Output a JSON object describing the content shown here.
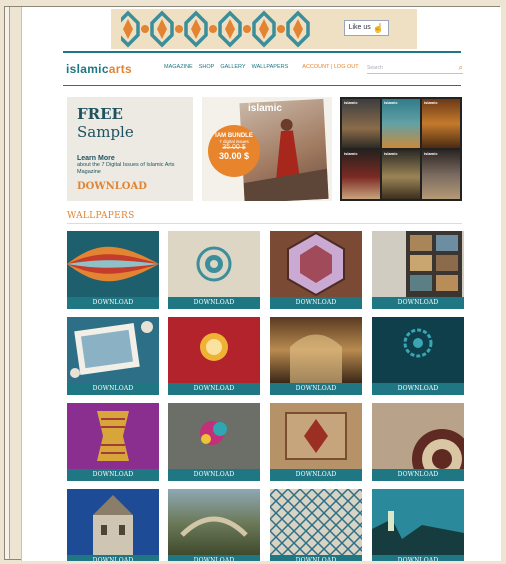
{
  "banner": {
    "like_label": "Like us"
  },
  "site": {
    "logo_main": "islamic",
    "logo_accent": "arts"
  },
  "nav": {
    "items": [
      "MAGAZINE",
      "SHOP",
      "GALLERY",
      "WALLPAPERS"
    ],
    "account": "ACCOUNT | LOG OUT"
  },
  "search": {
    "placeholder": "Search"
  },
  "promo": {
    "title_bold": "FREE",
    "title_rest": " Sample",
    "learn_more": "Learn More",
    "desc": "about the 7 Digital Issues of Islamic Arts Magazine",
    "download": "DOWNLOAD"
  },
  "bundle": {
    "mag_logo": "islamic",
    "line1": "IAM BUNDLE",
    "line2": "7 digital issues",
    "old_price": "35.00 $",
    "price": "30.00 $"
  },
  "covers": {
    "logo": "islamic"
  },
  "wallpapers": {
    "title": "WALLPAPERS",
    "download_label": "DOWNLOAD"
  }
}
